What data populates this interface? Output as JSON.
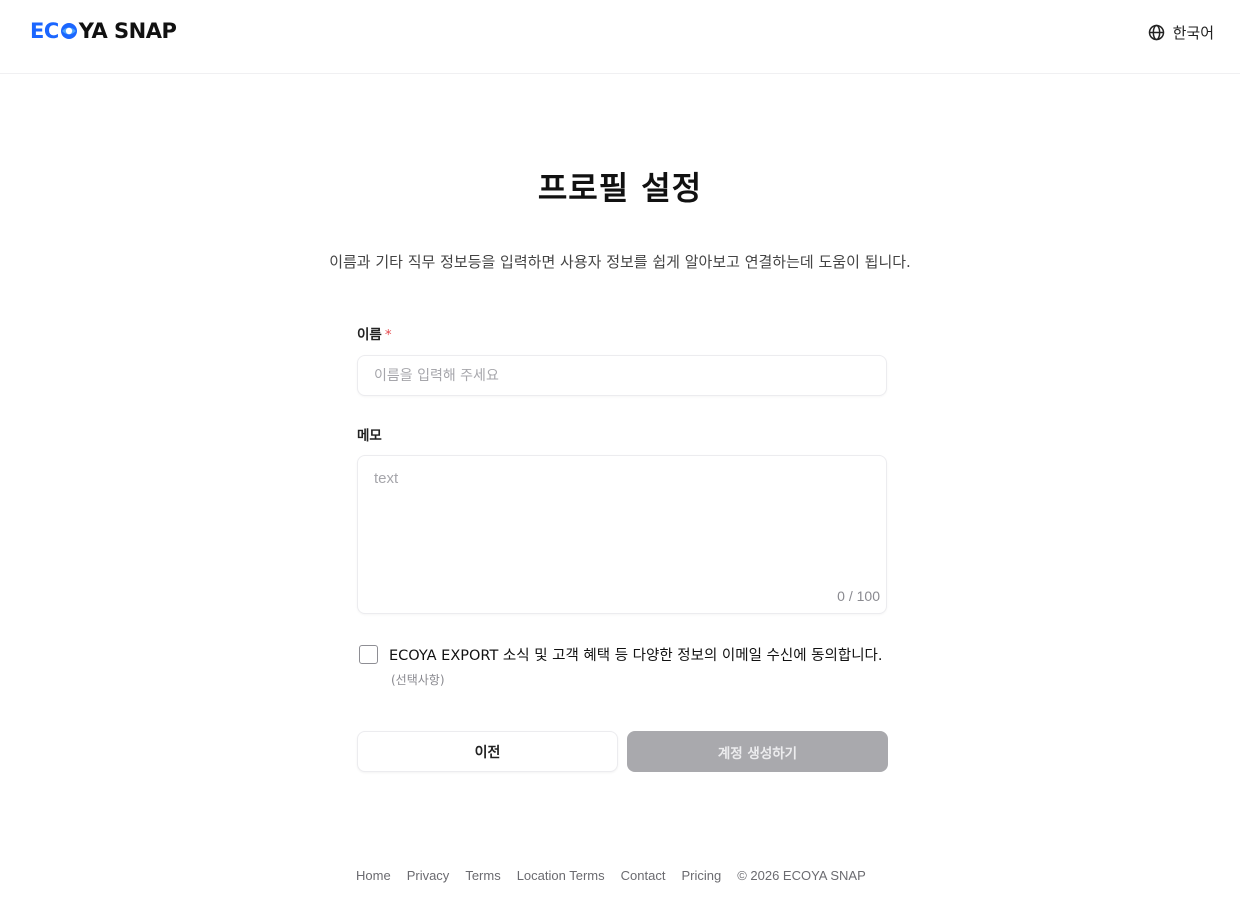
{
  "header": {
    "logo_prefix": "EC",
    "logo_suffix": "YA SNAP",
    "logo_text": "ECOYA SNAP",
    "language_icon": "globe-icon",
    "language_label": "한국어"
  },
  "page": {
    "title": "프로필 설정",
    "subtitle": "이름과 기타 직무 정보등을 입력하면 사용자 정보를 쉽게 알아보고 연결하는데 도움이 됩니다."
  },
  "form": {
    "name": {
      "label": "이름",
      "required_mark": "*",
      "value": "",
      "placeholder": "이름을 입력해 주세요"
    },
    "memo": {
      "label": "메모",
      "value": "",
      "placeholder": "text",
      "counter": "0 / 100"
    },
    "consent": {
      "checked": false,
      "text": "ECOYA EXPORT 소식 및 고객 혜택 등 다양한 정보의 이메일 수신에 동의합니다.",
      "optional_label": "(선택사항)"
    },
    "buttons": {
      "prev_label": "이전",
      "create_label": "계정 생성하기"
    }
  },
  "footer": {
    "links": [
      "Home",
      "Privacy",
      "Terms",
      "Location Terms",
      "Contact",
      "Pricing"
    ],
    "copyright": "© 2026 ECOYA SNAP"
  },
  "colors": {
    "brand_blue": "#1b66ff",
    "required_red": "#e5484d",
    "disabled_button": "#a9a9ad"
  }
}
